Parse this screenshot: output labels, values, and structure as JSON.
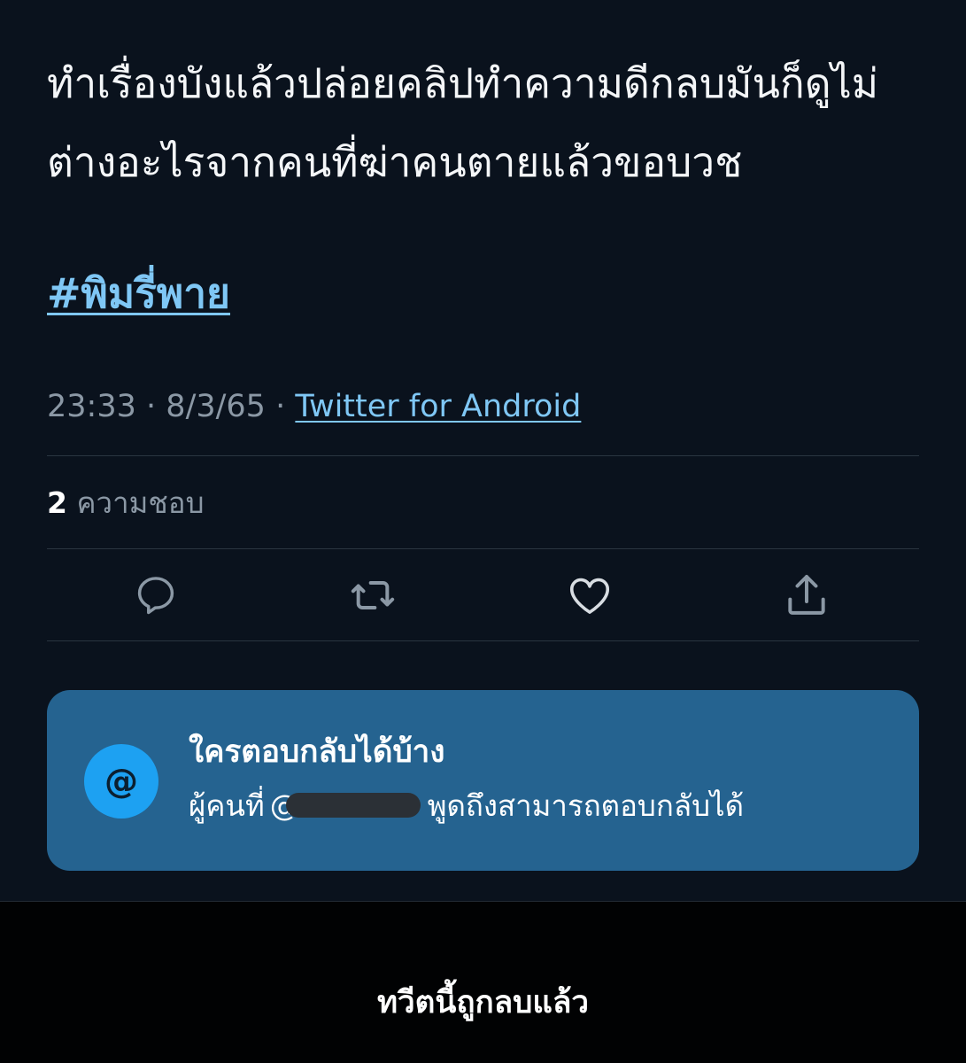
{
  "tweet": {
    "text": "ทำเรื่องบังแล้วปล่อยคลิปทำความดีกลบมันก็ดูไม่ต่างอะไรจากคนที่ฆ่าคนตายแล้วขอบวช",
    "hashtag": "#พิมรี่พาย",
    "time": "23:33",
    "separator": "·",
    "date": "8/3/65",
    "source": "Twitter for Android"
  },
  "stats": {
    "likes_count": "2",
    "likes_label": "ความชอบ"
  },
  "actions": [
    {
      "icon": "reply-icon"
    },
    {
      "icon": "retweet-icon"
    },
    {
      "icon": "like-icon"
    },
    {
      "icon": "share-icon"
    }
  ],
  "reply_settings": {
    "icon_glyph": "@",
    "title": "ใครตอบกลับได้บ้าง",
    "body_prefix": "ผู้คนที่",
    "mention_at": "@",
    "body_suffix": "พูดถึงสามารถตอบกลับได้"
  },
  "footer": {
    "deleted_notice": "ทวีตนี้ถูกลบแล้ว"
  },
  "colors": {
    "background": "#0a121d",
    "link": "#7fc7f5",
    "card": "#256390",
    "accent": "#1da1f2"
  }
}
